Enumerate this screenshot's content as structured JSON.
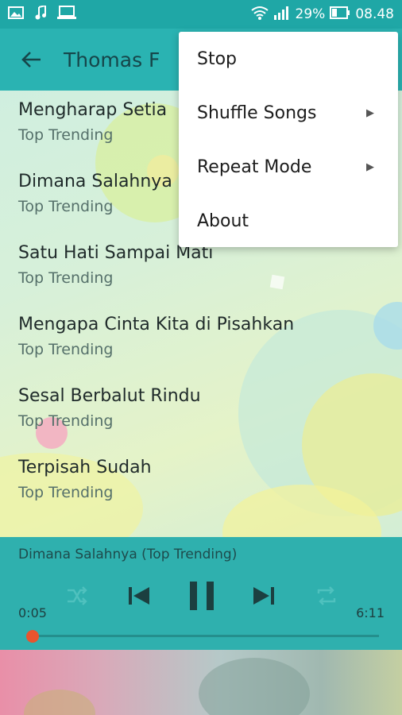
{
  "status_bar": {
    "battery_percent": "29%",
    "time": "08.48",
    "left_icons": [
      "gallery-icon",
      "music-note-icon",
      "laptop-icon"
    ],
    "right_icons": [
      "wifi-icon",
      "signal-icon",
      "battery-icon"
    ]
  },
  "appbar": {
    "title": "Thomas F"
  },
  "songs": [
    {
      "title": "Mengharap Setia",
      "subtitle": "Top Trending"
    },
    {
      "title": "Dimana Salahnya",
      "subtitle": "Top Trending"
    },
    {
      "title": "Satu Hati Sampai Mati",
      "subtitle": "Top Trending"
    },
    {
      "title": "Mengapa Cinta Kita di Pisahkan",
      "subtitle": "Top Trending"
    },
    {
      "title": "Sesal Berbalut Rindu",
      "subtitle": "Top Trending"
    },
    {
      "title": "Terpisah Sudah",
      "subtitle": "Top Trending"
    }
  ],
  "player": {
    "now_playing": "Dimana Salahnya (Top Trending)",
    "elapsed": "0:05",
    "duration": "6:11",
    "progress_fraction": 0.01
  },
  "menu": {
    "items": [
      {
        "label": "Stop",
        "submenu": false
      },
      {
        "label": "Shuffle Songs",
        "submenu": true
      },
      {
        "label": "Repeat Mode",
        "submenu": true
      },
      {
        "label": "About",
        "submenu": false
      }
    ]
  },
  "colors": {
    "status_bar": "#1fa7a6",
    "app_bar": "#2ab3b2",
    "player": "#2fb0ae",
    "seek_knob": "#e8542e"
  }
}
